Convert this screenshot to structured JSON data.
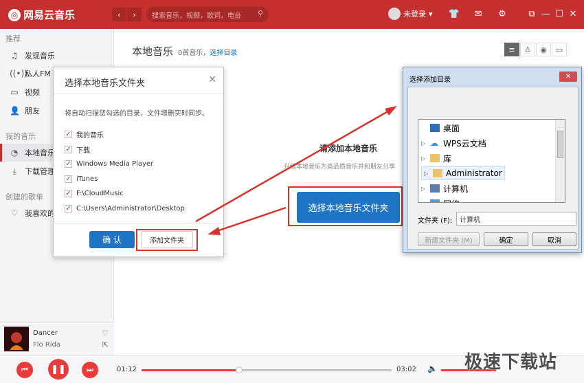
{
  "app": {
    "name": "网易云音乐"
  },
  "header": {
    "back": "‹",
    "forward": "›",
    "search_placeholder": "搜索音乐，视频，歌词，电台",
    "user_label": "未登录"
  },
  "sidebar": {
    "sections": [
      {
        "heading": "推荐",
        "items": [
          {
            "label": "发现音乐",
            "icon": "music-note-icon"
          },
          {
            "label": "私人FM",
            "icon": "radio-icon"
          },
          {
            "label": "视频",
            "icon": "video-icon"
          },
          {
            "label": "朋友",
            "icon": "friends-icon"
          }
        ]
      },
      {
        "heading": "我的音乐",
        "items": [
          {
            "label": "本地音乐",
            "icon": "local-music-icon",
            "active": true
          },
          {
            "label": "下载管理",
            "icon": "download-icon"
          }
        ]
      },
      {
        "heading": "创建的歌单",
        "items": [
          {
            "label": "我喜欢的",
            "icon": "heart-icon"
          }
        ]
      }
    ]
  },
  "now_playing": {
    "title": "Dancer",
    "artist": "Flo Rida"
  },
  "main": {
    "title": "本地音乐",
    "count": "0首音乐，",
    "select_link": "选择目录",
    "empty_title": "请添加本地音乐",
    "empty_desc": "升级本地音乐为高品质音乐并和朋友分享",
    "choose_button": "选择本地音乐文件夹"
  },
  "folder_dialog": {
    "title": "选择本地音乐文件夹",
    "description": "将自动扫描您勾选的目录，文件增删实时同步。",
    "folders": [
      {
        "label": "我的音乐",
        "checked": true
      },
      {
        "label": "下载",
        "checked": true
      },
      {
        "label": "Windows Media Player",
        "checked": true
      },
      {
        "label": "iTunes",
        "checked": true
      },
      {
        "label": "F:\\CloudMusic",
        "checked": true
      },
      {
        "label": "C:\\Users\\Administrator\\Desktop",
        "checked": true
      }
    ],
    "confirm_button": "确 认",
    "add_button": "添加文件夹"
  },
  "win_dialog": {
    "title": "选择添加目录",
    "tree": [
      {
        "label": "桌面",
        "icon": "desktop-icon",
        "arrow": ""
      },
      {
        "label": "WPS云文档",
        "icon": "cloud-icon",
        "arrow": "▷"
      },
      {
        "label": "库",
        "icon": "library-icon",
        "arrow": "▷"
      },
      {
        "label": "Administrator",
        "icon": "user-folder-icon",
        "arrow": "▷",
        "selected": true
      },
      {
        "label": "计算机",
        "icon": "computer-icon",
        "arrow": "▷"
      },
      {
        "label": "网络",
        "icon": "network-icon",
        "arrow": "▷"
      }
    ],
    "folder_label": "文件夹 (F):",
    "folder_value": "计算机",
    "new_folder_button": "新建文件夹 (M)",
    "ok_button": "确定",
    "cancel_button": "取消"
  },
  "player": {
    "current_time": "01:12",
    "total_time": "03:02",
    "progress": 0.39
  },
  "watermark": "极速下载站",
  "colors": {
    "brand": "#c62f2f",
    "accent_blue": "#1f75c4",
    "highlight": "#d8322c"
  }
}
